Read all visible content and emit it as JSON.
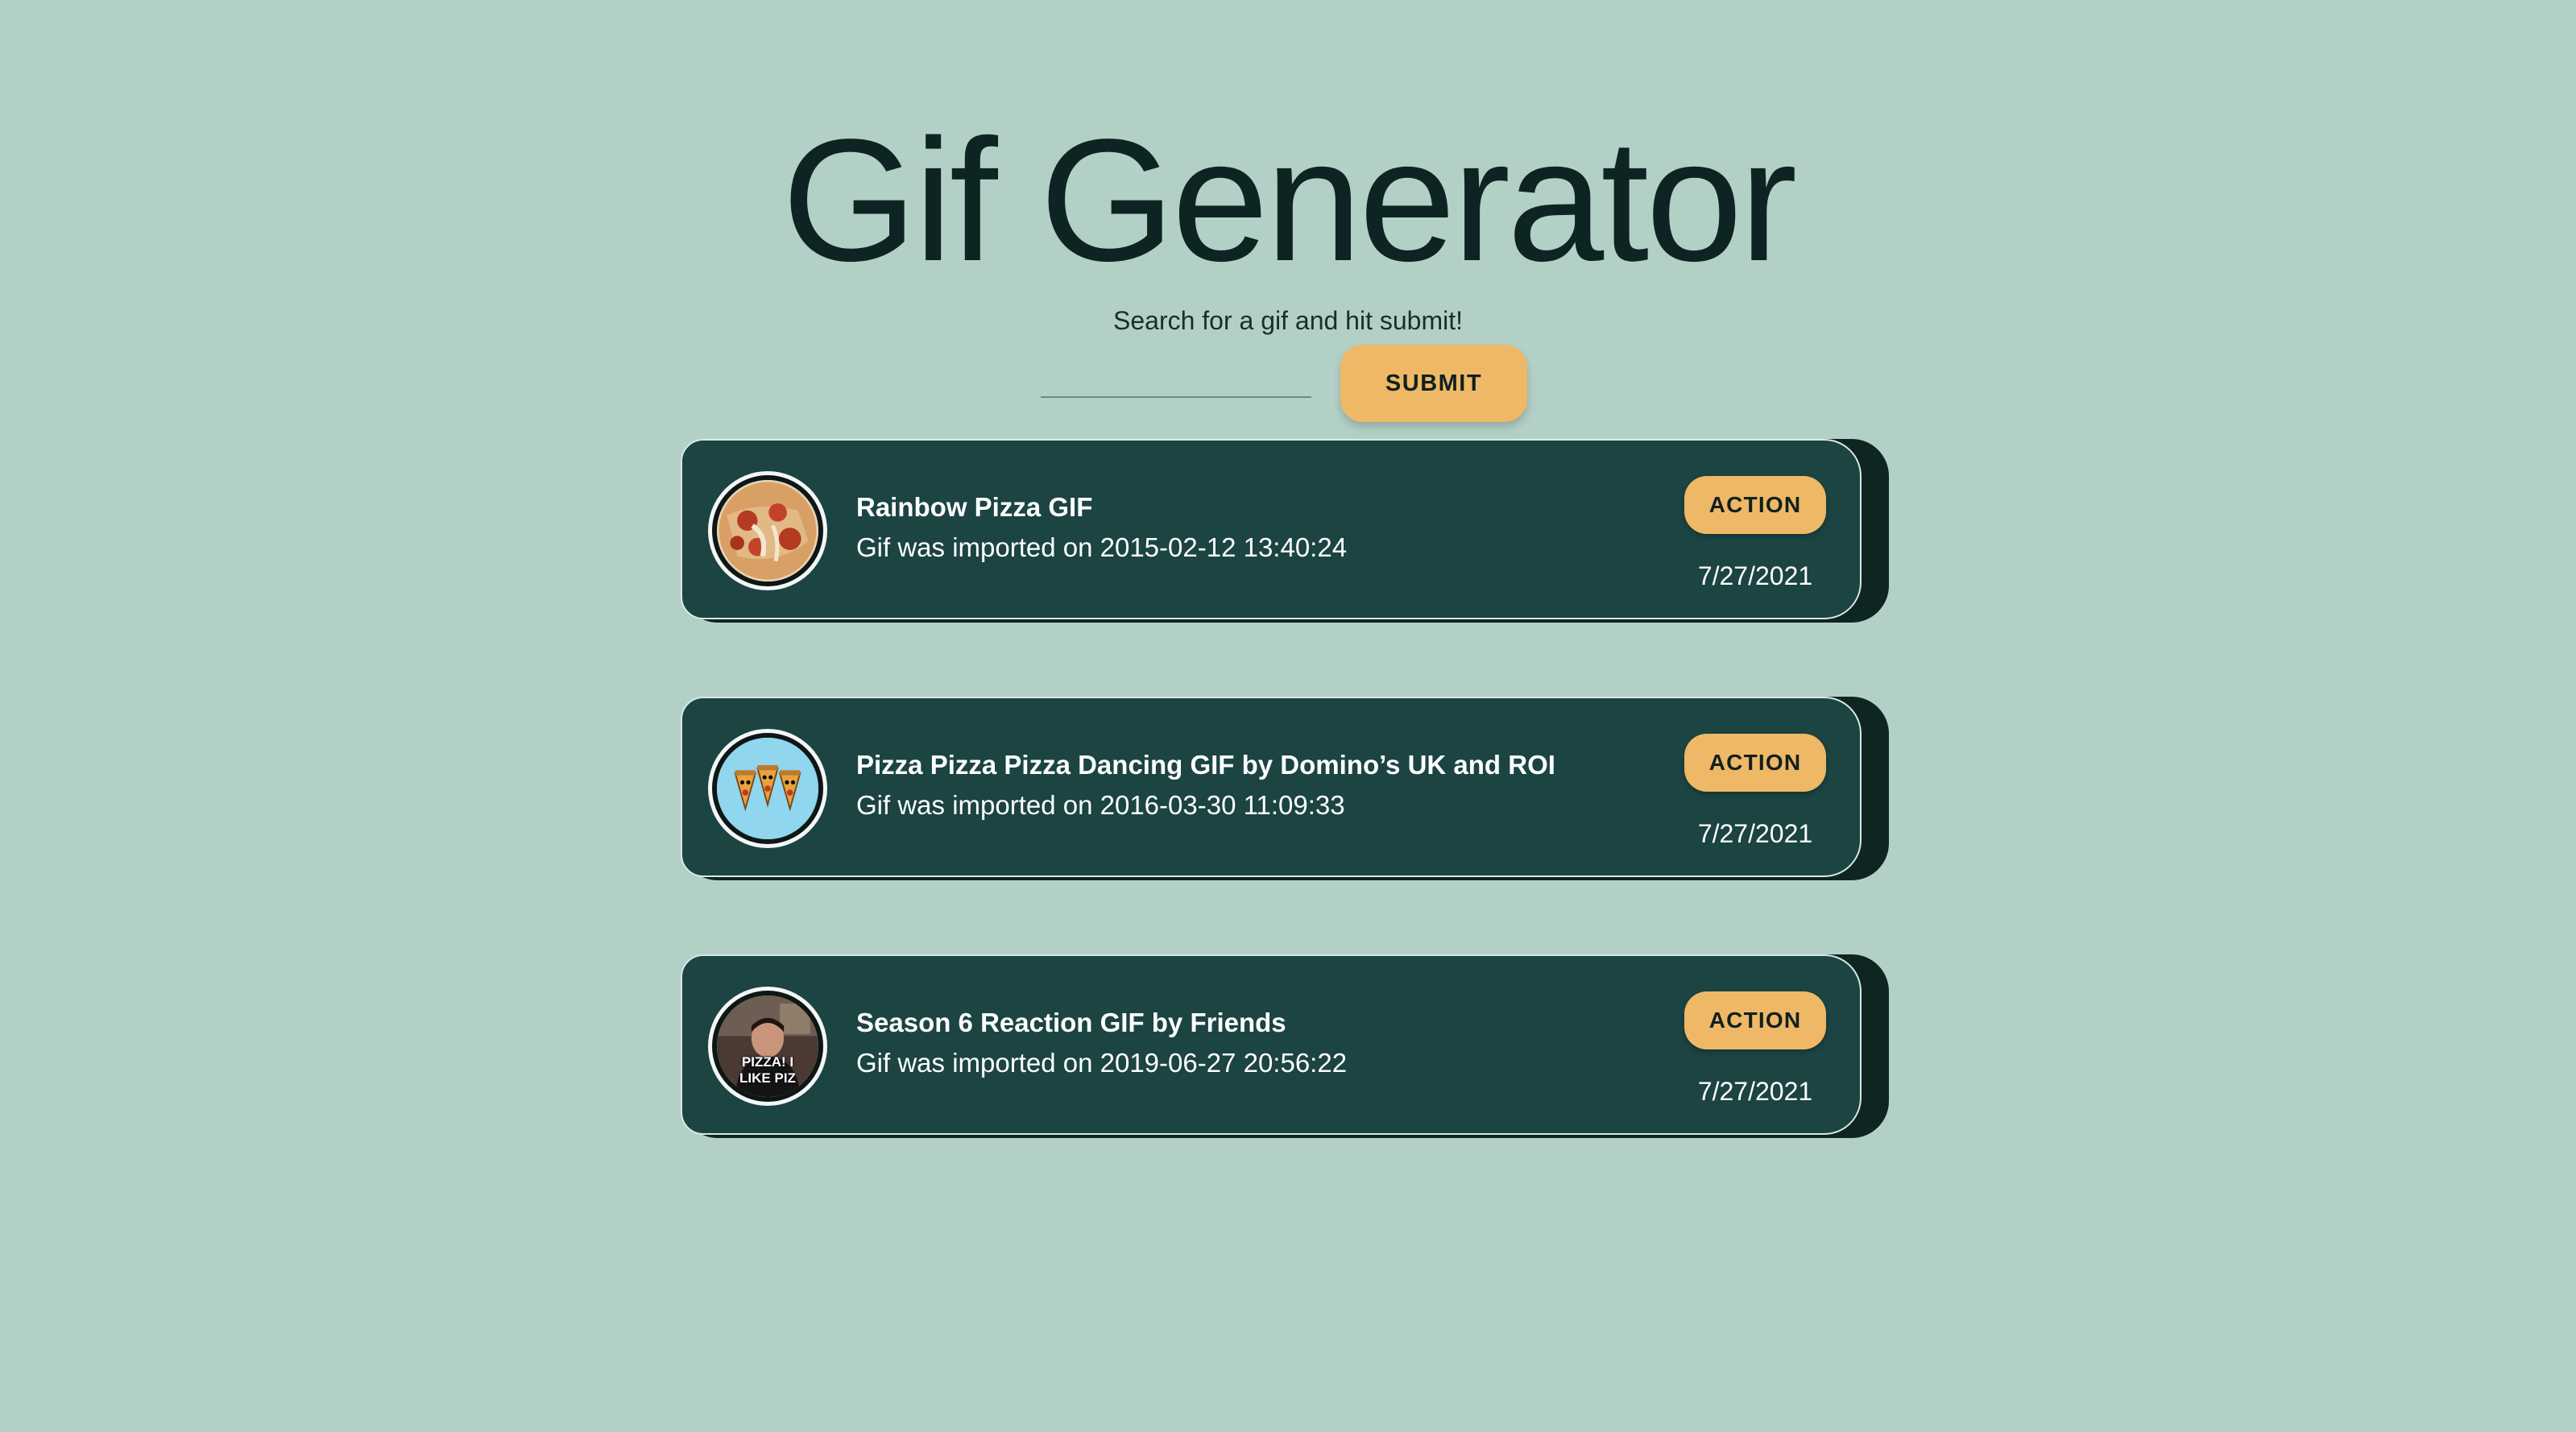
{
  "header": {
    "title": "Gif Generator",
    "subtitle": "Search for a gif and hit submit!"
  },
  "search": {
    "value": "",
    "placeholder": "",
    "submit_label": "SUBMIT"
  },
  "results": [
    {
      "title": "Rainbow Pizza GIF",
      "subtitle": "Gif was imported on 2015-02-12 13:40:24",
      "action_label": "ACTION",
      "date": "7/27/2021",
      "thumbnail": "pizza-slice-thumbnail"
    },
    {
      "title": "Pizza Pizza Pizza Dancing GIF by Domino’s UK and ROI",
      "subtitle": "Gif was imported on 2016-03-30 11:09:33",
      "action_label": "ACTION",
      "date": "7/27/2021",
      "thumbnail": "dancing-pizza-slices-thumbnail"
    },
    {
      "title": "Season 6 Reaction GIF by Friends",
      "subtitle": "Gif was imported on 2019-06-27 20:56:22",
      "action_label": "ACTION",
      "date": "7/27/2021",
      "thumbnail": "friends-reaction-thumbnail",
      "thumbnail_caption": "PIZZA! I LIKE PIZ"
    }
  ],
  "colors": {
    "background": "#b3d0c6",
    "card": "#1b4443",
    "card_shadow": "#0e2522",
    "accent": "#efb866",
    "title_text": "#0e2422"
  }
}
